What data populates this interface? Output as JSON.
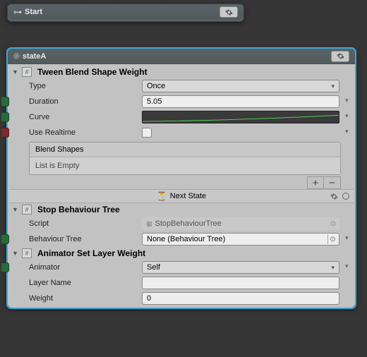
{
  "start": {
    "title": "Start"
  },
  "stateA": {
    "title": "stateA",
    "tween": {
      "title": "Tween Blend Shape Weight",
      "type_label": "Type",
      "type_value": "Once",
      "duration_label": "Duration",
      "duration_value": "5.05",
      "curve_label": "Curve",
      "realtime_label": "Use Realtime",
      "blendshapes_header": "Blend Shapes",
      "blendshapes_empty": "List is Empty"
    },
    "transition": {
      "label": "Next State"
    },
    "stopBT": {
      "title": "Stop Behaviour Tree",
      "script_label": "Script",
      "script_value": "StopBehaviourTree",
      "bt_label": "Behaviour Tree",
      "bt_value": "None (Behaviour Tree)"
    },
    "animLayer": {
      "title": "Animator Set Layer Weight",
      "animator_label": "Animator",
      "animator_value": "Self",
      "layername_label": "Layer Name",
      "layername_value": "",
      "weight_label": "Weight",
      "weight_value": "0"
    }
  }
}
